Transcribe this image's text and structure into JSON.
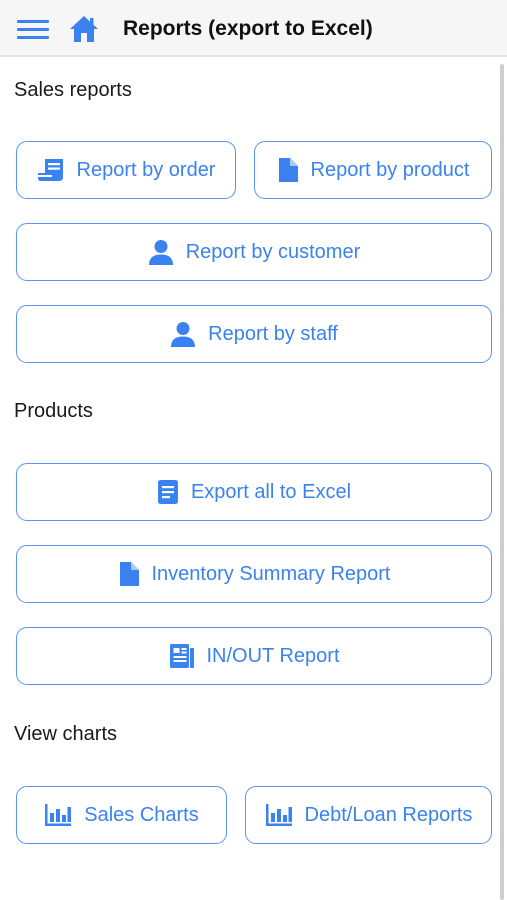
{
  "header": {
    "title": "Reports (export to Excel)",
    "menu_icon": "hamburger-menu-icon",
    "home_icon": "home-icon"
  },
  "accent_color": "#3a82f0",
  "sections": {
    "sales": {
      "title": "Sales reports",
      "report_by_order": {
        "label": "Report by order",
        "icon": "receipt-icon"
      },
      "report_by_product": {
        "label": "Report by product",
        "icon": "document-icon"
      },
      "report_by_customer": {
        "label": "Report by customer",
        "icon": "person-icon"
      },
      "report_by_staff": {
        "label": "Report by staff",
        "icon": "person-icon"
      }
    },
    "products": {
      "title": "Products",
      "export_all": {
        "label": "Export all to Excel",
        "icon": "document-lines-icon"
      },
      "inventory_summary": {
        "label": "Inventory Summary Report",
        "icon": "document-icon"
      },
      "in_out_report": {
        "label": "IN/OUT Report",
        "icon": "ledger-icon"
      }
    },
    "charts": {
      "title": "View charts",
      "sales_charts": {
        "label": "Sales Charts",
        "icon": "bar-chart-icon"
      },
      "debt_loan_reports": {
        "label": "Debt/Loan Reports",
        "icon": "bar-chart-icon"
      }
    }
  }
}
